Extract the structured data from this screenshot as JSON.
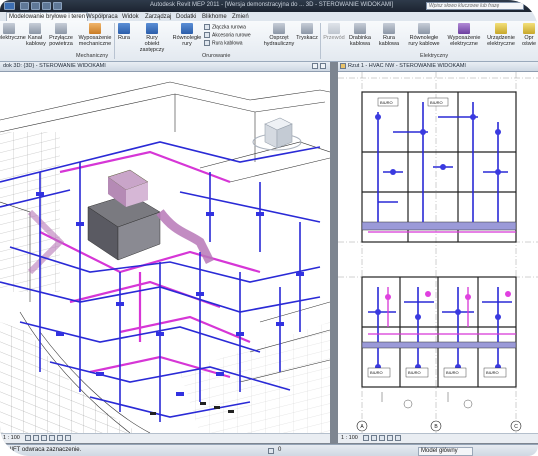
{
  "title_bar": {
    "title": "Autodesk Revit MEP 2011 - [Wersja demonstracyjna do ... 3D - STEROWANIE WIDOKAMI]",
    "search_placeholder": "Wpisz słowo kluczowe lub frazę"
  },
  "tabs": [
    "Modelowanie bryłowe i teren",
    "Współpraca",
    "Widok",
    "Zarządzaj",
    "Dodatki",
    "Blikhome",
    "Zmień"
  ],
  "ribbon": {
    "buttons": [
      {
        "label": "Korytka",
        "sub": "elektryczne"
      },
      {
        "label": "Kanał",
        "sub": "kablowy"
      },
      {
        "label": "Przyłącze",
        "sub": "powietrza"
      },
      {
        "label": "Wyposażenie",
        "sub": "mechaniczne"
      },
      {
        "label": "Rura",
        "sub": ""
      },
      {
        "label": "Rury",
        "sub": "obiekt zastępczy"
      },
      {
        "label": "Równoległe",
        "sub": "rury"
      },
      {
        "label": "Osprzęt",
        "sub": "hydrauliczny"
      },
      {
        "label": "Tryskacz",
        "sub": ""
      },
      {
        "label": "Przewód",
        "sub": ""
      },
      {
        "label": "Drabinka",
        "sub": "kablowa"
      },
      {
        "label": "Rura kablowa",
        "sub": ""
      },
      {
        "label": "Równoległe",
        "sub": "rury kablowe"
      },
      {
        "label": "Wyposażenie",
        "sub": "elektryczne"
      },
      {
        "label": "Urządzenie",
        "sub": "elektryczne"
      },
      {
        "label": "Opr",
        "sub": "oświe"
      }
    ],
    "small_list": [
      "Złączka rurowa",
      "Akcesoria rurowe",
      "Rura kablowa"
    ],
    "panels": [
      "Mechaniczny",
      "Orurowanie",
      "Elektryczny"
    ]
  },
  "views": {
    "left_title": "dok 3D: {3D} - STEROWANIE WIDOKAMI",
    "right_title": "Rzut 1 - HVAC NW - STEROWANIE WIDOKAMI",
    "left_scale": "1 : 100",
    "right_scale": "1 : 100"
  },
  "status": {
    "message": "SHIFT odwraca zaznaczenie.",
    "model_label": "Model główny",
    "filter_value": "0"
  },
  "room_labels": [
    "BIURO",
    "BIURO",
    "BIURO",
    "BIURO",
    "BIURO",
    "BIURO"
  ],
  "grid_labels": [
    "A",
    "B",
    "C"
  ],
  "colors": {
    "duct_blue": "#2a2ad6",
    "pipe_magenta": "#d62ad6",
    "title_bar": "#1f2733"
  }
}
